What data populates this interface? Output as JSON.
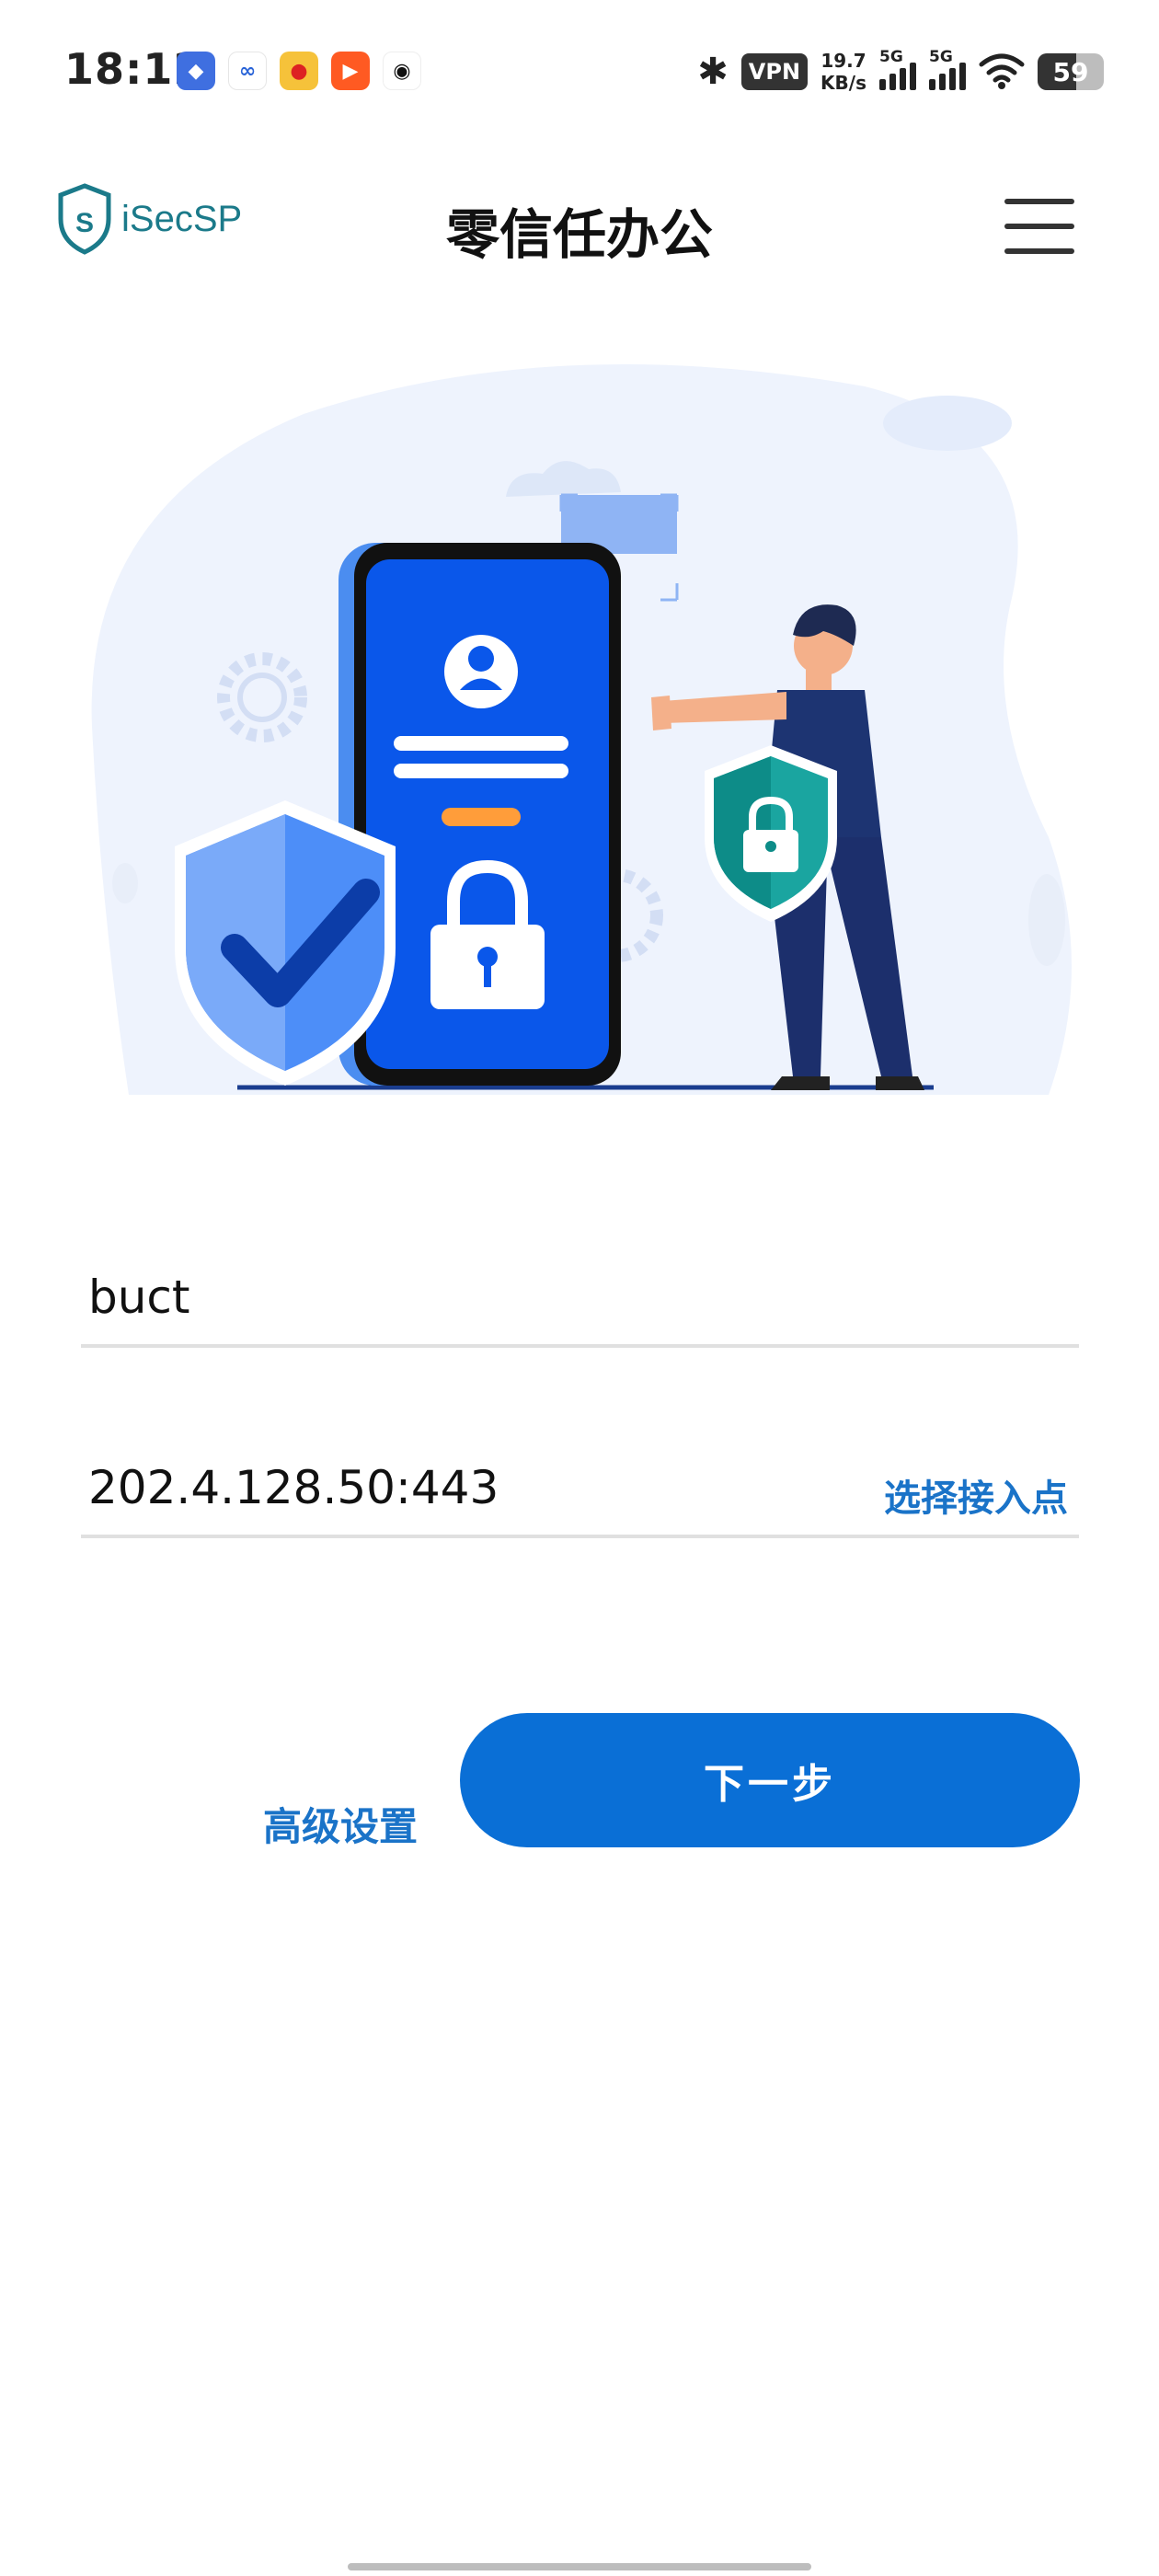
{
  "status_bar": {
    "time": "18:12",
    "vpn_label": "VPN",
    "speed_value": "19.7",
    "speed_unit": "KB/s",
    "sim1_label": "5G",
    "sim2_label": "5G",
    "battery": "59",
    "notification_icons": [
      "shield-app-icon",
      "mail-icon",
      "weibo-icon",
      "kuaishou-icon",
      "qq-icon"
    ]
  },
  "header": {
    "logo_text": "iSecSP",
    "title": "零信任办公",
    "menu_icon": "hamburger-menu-icon"
  },
  "form": {
    "org_value": "buct",
    "address_value": "202.4.128.50:443",
    "pick_access_point_label": "选择接入点"
  },
  "actions": {
    "advanced_label": "高级设置",
    "next_label": "下一步"
  },
  "colors": {
    "accent": "#0a6fd6",
    "link": "#1a73c8",
    "logo": "#1b7a8a"
  }
}
